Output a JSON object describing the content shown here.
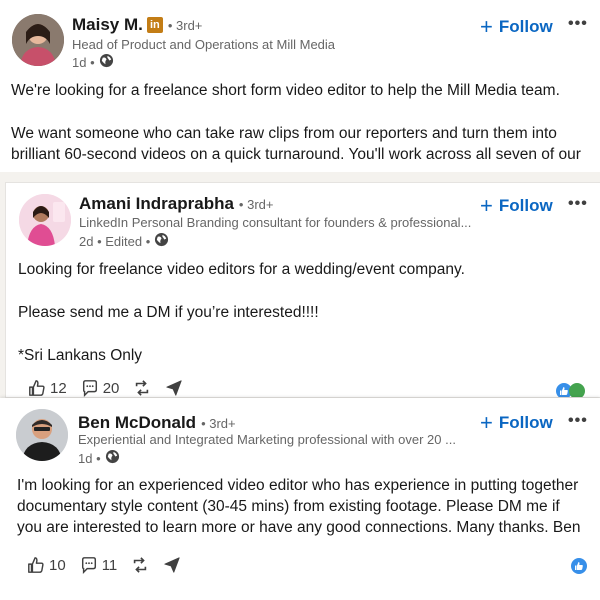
{
  "posts": [
    {
      "author": "Maisy M.",
      "badge": "in",
      "degree": "• 3rd+",
      "headline": "Head of Product and Operations at Mill Media",
      "meta": "1d •",
      "follow_label": "Follow",
      "paragraphs": [
        "We're looking for a freelance short form video editor to help the Mill Media team.",
        "We want someone who can take raw clips from our reporters and turn them into brilliant 60-second videos on a quick turnaround. You'll work across all seven of our"
      ]
    },
    {
      "author": "Amani Indraprabha",
      "degree": "• 3rd+",
      "headline": "LinkedIn Personal Branding consultant for founders & professional...",
      "meta": "2d • Edited •",
      "follow_label": "Follow",
      "paragraphs": [
        "Looking for freelance video editors for a wedding/event company.",
        "Please send me a DM if you’re interested!!!!",
        "*Sri Lankans Only"
      ],
      "likes": "12",
      "comments": "20"
    },
    {
      "author": "Ben McDonald",
      "degree": "• 3rd+",
      "headline": "Experiential and Integrated Marketing professional with over 20 ...",
      "meta": "1d •",
      "follow_label": "Follow",
      "paragraphs": [
        "I'm looking for an experienced video editor who has experience in putting together documentary style content (30-45 mins) from existing footage.  Please DM me if you are interested to learn more or have any good connections.  Many thanks.  Ben"
      ],
      "likes": "10",
      "comments": "11"
    }
  ],
  "colors": {
    "accent": "#0a66c2",
    "badge_gold": "#c37d16",
    "text_muted": "#666666"
  },
  "icons": [
    "globe-icon",
    "like-icon",
    "comment-icon",
    "repost-icon",
    "send-icon",
    "more-icon"
  ]
}
